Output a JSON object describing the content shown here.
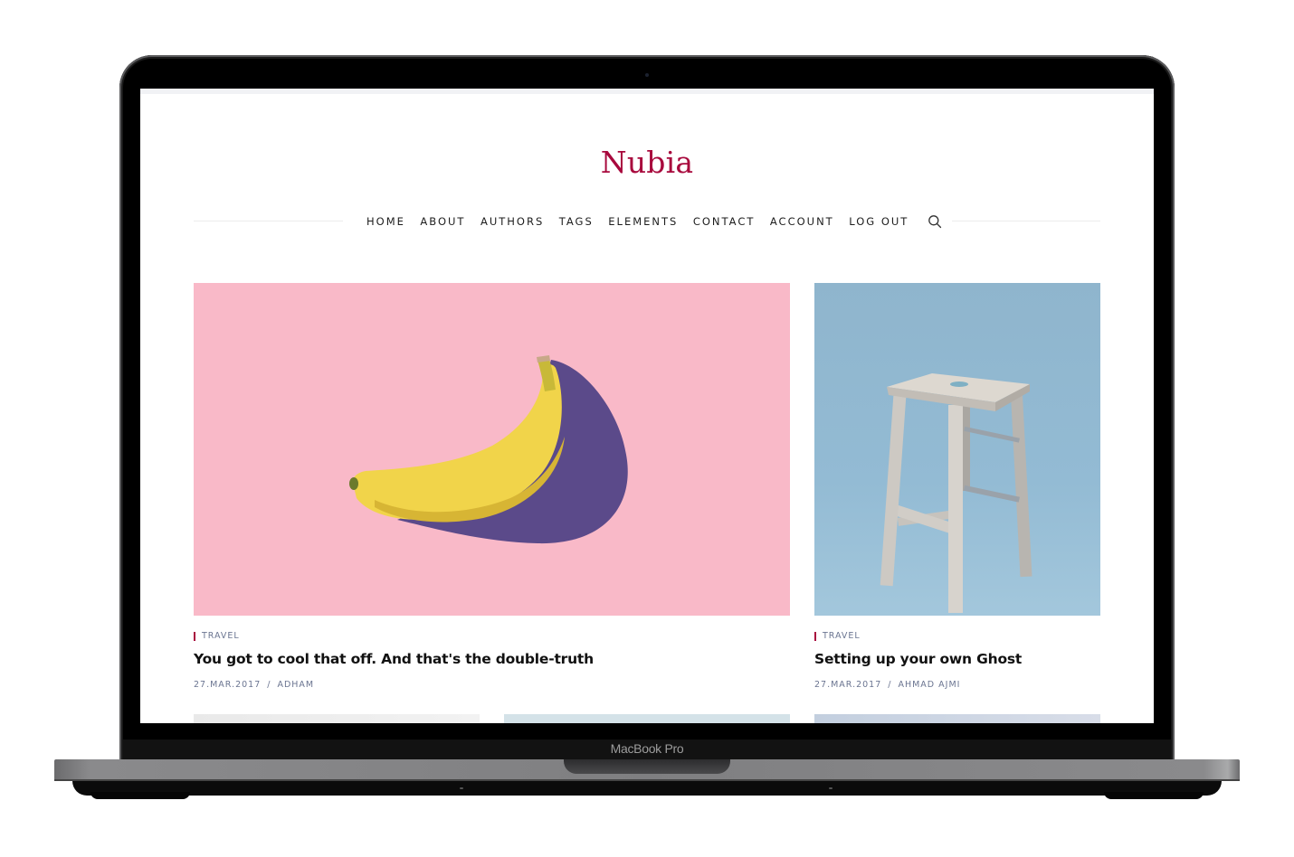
{
  "device": {
    "label": "MacBook Pro"
  },
  "site": {
    "title": "Nubia",
    "accent_color": "#a8093d"
  },
  "nav": {
    "items": [
      {
        "label": "HOME"
      },
      {
        "label": "ABOUT"
      },
      {
        "label": "AUTHORS"
      },
      {
        "label": "TAGS"
      },
      {
        "label": "ELEMENTS"
      },
      {
        "label": "CONTACT"
      },
      {
        "label": "ACCOUNT"
      },
      {
        "label": "LOG OUT"
      }
    ],
    "search_icon": "search-icon"
  },
  "posts": [
    {
      "image": "banana-on-pink-background",
      "tag": "TRAVEL",
      "title": "You got to cool that off. And that's the double-truth",
      "date": "27.MAR.2017",
      "separator": "/",
      "author": "ADHAM"
    },
    {
      "image": "wooden-stool-on-blue-background",
      "tag": "TRAVEL",
      "title": "Setting up your own Ghost",
      "date": "27.MAR.2017",
      "separator": "/",
      "author": "AHMAD AJMI"
    }
  ]
}
